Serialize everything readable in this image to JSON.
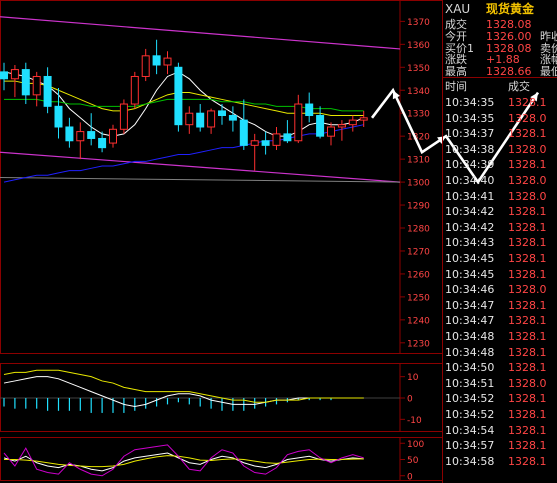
{
  "chart_data": [
    {
      "type": "candlestick",
      "title": "",
      "y_ticks": [
        1230,
        1240,
        1250,
        1260,
        1270,
        1280,
        1290,
        1300,
        1310,
        1320,
        1330,
        1340,
        1350,
        1360,
        1370
      ],
      "ylim": [
        1226,
        1378
      ],
      "candles": [
        {
          "o": 1348,
          "h": 1352,
          "l": 1340,
          "c": 1345
        },
        {
          "o": 1345,
          "h": 1351,
          "l": 1337,
          "c": 1349
        },
        {
          "o": 1349,
          "h": 1352,
          "l": 1334,
          "c": 1338
        },
        {
          "o": 1338,
          "h": 1348,
          "l": 1333,
          "c": 1346
        },
        {
          "o": 1346,
          "h": 1350,
          "l": 1330,
          "c": 1333
        },
        {
          "o": 1333,
          "h": 1341,
          "l": 1319,
          "c": 1324
        },
        {
          "o": 1324,
          "h": 1328,
          "l": 1315,
          "c": 1318
        },
        {
          "o": 1318,
          "h": 1326,
          "l": 1310,
          "c": 1322
        },
        {
          "o": 1322,
          "h": 1330,
          "l": 1316,
          "c": 1319
        },
        {
          "o": 1319,
          "h": 1322,
          "l": 1313,
          "c": 1315
        },
        {
          "o": 1317,
          "h": 1325,
          "l": 1315,
          "c": 1323
        },
        {
          "o": 1323,
          "h": 1336,
          "l": 1321,
          "c": 1334
        },
        {
          "o": 1334,
          "h": 1348,
          "l": 1332,
          "c": 1346
        },
        {
          "o": 1346,
          "h": 1358,
          "l": 1344,
          "c": 1355
        },
        {
          "o": 1355,
          "h": 1362,
          "l": 1347,
          "c": 1351
        },
        {
          "o": 1351,
          "h": 1357,
          "l": 1347,
          "c": 1354
        },
        {
          "o": 1350,
          "h": 1352,
          "l": 1322,
          "c": 1325
        },
        {
          "o": 1325,
          "h": 1333,
          "l": 1321,
          "c": 1330
        },
        {
          "o": 1330,
          "h": 1334,
          "l": 1322,
          "c": 1324
        },
        {
          "o": 1324,
          "h": 1332,
          "l": 1321,
          "c": 1331
        },
        {
          "o": 1331,
          "h": 1334,
          "l": 1325,
          "c": 1329
        },
        {
          "o": 1329,
          "h": 1333,
          "l": 1322,
          "c": 1327
        },
        {
          "o": 1327,
          "h": 1336,
          "l": 1314,
          "c": 1316
        },
        {
          "o": 1316,
          "h": 1321,
          "l": 1305,
          "c": 1318
        },
        {
          "o": 1318,
          "h": 1322,
          "l": 1312,
          "c": 1316
        },
        {
          "o": 1316,
          "h": 1324,
          "l": 1314,
          "c": 1321
        },
        {
          "o": 1321,
          "h": 1327,
          "l": 1317,
          "c": 1318
        },
        {
          "o": 1318,
          "h": 1338,
          "l": 1317,
          "c": 1334
        },
        {
          "o": 1334,
          "h": 1339,
          "l": 1326,
          "c": 1329
        },
        {
          "o": 1329,
          "h": 1333,
          "l": 1319,
          "c": 1320
        },
        {
          "o": 1320,
          "h": 1326,
          "l": 1316,
          "c": 1324
        },
        {
          "o": 1324,
          "h": 1327,
          "l": 1318,
          "c": 1325
        },
        {
          "o": 1325,
          "h": 1329,
          "l": 1322,
          "c": 1327
        },
        {
          "o": 1327,
          "h": 1331,
          "l": 1324,
          "c": 1328
        }
      ],
      "lines": [
        {
          "color": "#ffffff",
          "values": [
            1348,
            1347,
            1346,
            1344,
            1342,
            1338,
            1332,
            1328,
            1324,
            1321,
            1320,
            1321,
            1325,
            1332,
            1340,
            1346,
            1348,
            1345,
            1340,
            1336,
            1333,
            1330,
            1327,
            1325,
            1322,
            1320,
            1320,
            1322,
            1325,
            1326,
            1325,
            1325,
            1326,
            1328
          ]
        },
        {
          "color": "#e8e800",
          "values": [
            1344,
            1344,
            1343,
            1343,
            1342,
            1340,
            1338,
            1336,
            1334,
            1332,
            1331,
            1331,
            1332,
            1334,
            1336,
            1338,
            1339,
            1339,
            1338,
            1337,
            1336,
            1335,
            1334,
            1333,
            1332,
            1331,
            1330,
            1330,
            1330,
            1330,
            1329,
            1329,
            1329,
            1329
          ]
        },
        {
          "color": "#00c000",
          "values": [
            1336,
            1336,
            1336,
            1336,
            1335,
            1335,
            1334,
            1334,
            1333,
            1333,
            1333,
            1333,
            1333,
            1334,
            1335,
            1336,
            1336,
            1336,
            1336,
            1336,
            1335,
            1335,
            1335,
            1334,
            1334,
            1333,
            1333,
            1333,
            1332,
            1332,
            1332,
            1331,
            1331,
            1331
          ]
        },
        {
          "color": "#2020ff",
          "values": [
            1300,
            1301,
            1302,
            1303,
            1303,
            1304,
            1305,
            1305,
            1306,
            1307,
            1307,
            1308,
            1309,
            1309,
            1310,
            1311,
            1312,
            1312,
            1313,
            1314,
            1315,
            1315,
            1316,
            1317,
            1318,
            1318,
            1319,
            1320,
            1321,
            1321,
            1322,
            1323,
            1324,
            1325
          ]
        }
      ],
      "channel_lines": [
        {
          "from": 1372,
          "to": 1358
        },
        {
          "from": 1313,
          "to": 1300
        }
      ],
      "bottom_line": {
        "color": "#808080",
        "from": 1302,
        "to": 1300
      },
      "projection_path": [
        1328,
        1340,
        1313,
        1320,
        1300,
        1339
      ]
    },
    {
      "type": "bar",
      "title": "",
      "y_ticks": [
        10,
        0,
        -10
      ],
      "ylim": [
        -15,
        15
      ],
      "bars": [
        -4,
        -5,
        -5,
        -5,
        -6,
        -6,
        -6,
        -6,
        -7,
        -7,
        -7,
        -7,
        -6,
        -5,
        -4,
        -3,
        -2,
        -3,
        -4,
        -5,
        -6,
        -6,
        -6,
        -5,
        -4,
        -3,
        -2,
        -1,
        -1,
        -1,
        -1,
        0,
        0,
        0
      ],
      "lines": [
        {
          "color": "#ffffff",
          "values": [
            7,
            8,
            9,
            10,
            10,
            9,
            7,
            5,
            3,
            1,
            -1,
            -3,
            -4,
            -3,
            -1,
            1,
            2,
            2,
            1,
            -1,
            -2,
            -3,
            -3,
            -3,
            -2,
            -1,
            -1,
            0,
            0,
            0,
            0,
            0,
            0,
            0
          ]
        },
        {
          "color": "#e8e800",
          "values": [
            11,
            12,
            12,
            13,
            13,
            13,
            12,
            11,
            10,
            8,
            7,
            5,
            4,
            3,
            3,
            3,
            3,
            3,
            2,
            1,
            0,
            -1,
            -1,
            -2,
            -2,
            -1,
            -1,
            -1,
            0,
            0,
            0,
            0,
            0,
            0
          ]
        }
      ]
    },
    {
      "type": "line",
      "title": "",
      "y_ticks": [
        100,
        50,
        0
      ],
      "ylim": [
        -10,
        110
      ],
      "lines": [
        {
          "color": "#ffffff",
          "values": [
            55,
            45,
            60,
            40,
            30,
            25,
            35,
            30,
            20,
            15,
            25,
            45,
            55,
            60,
            65,
            70,
            55,
            40,
            35,
            50,
            60,
            55,
            40,
            30,
            25,
            35,
            50,
            55,
            60,
            50,
            45,
            50,
            55,
            52
          ]
        },
        {
          "color": "#e8e800",
          "values": [
            50,
            50,
            48,
            45,
            40,
            35,
            32,
            30,
            28,
            28,
            30,
            35,
            45,
            52,
            58,
            62,
            60,
            55,
            48,
            47,
            50,
            52,
            50,
            45,
            40,
            38,
            42,
            46,
            50,
            51,
            50,
            50,
            51,
            52
          ]
        },
        {
          "color": "#cc00cc",
          "values": [
            70,
            30,
            85,
            20,
            10,
            5,
            40,
            20,
            5,
            0,
            20,
            60,
            80,
            85,
            90,
            95,
            60,
            20,
            15,
            55,
            80,
            70,
            30,
            10,
            5,
            25,
            65,
            75,
            80,
            55,
            40,
            55,
            65,
            55
          ]
        }
      ]
    }
  ],
  "quote": {
    "symbol": "XAU",
    "name": "现货黄金",
    "rows": [
      {
        "label": "成交",
        "value": "1328.08",
        "extra": ""
      },
      {
        "label": "今开",
        "value": "1326.00",
        "extra": "昨收"
      },
      {
        "label": "买价1",
        "value": "1328.08",
        "extra": "卖价"
      },
      {
        "label": "涨跌",
        "value": "+1.88",
        "extra": "涨幅"
      },
      {
        "label": "最高",
        "value": "1328.66",
        "extra": "最低"
      }
    ],
    "ticks_header": {
      "time": "时间",
      "price": "成交"
    },
    "ticks": [
      {
        "time": "10:34:35",
        "price": "1328.1"
      },
      {
        "time": "10:34:35",
        "price": "1328.0"
      },
      {
        "time": "10:34:37",
        "price": "1328.1"
      },
      {
        "time": "10:34:38",
        "price": "1328.0"
      },
      {
        "time": "10:34:39",
        "price": "1328.1"
      },
      {
        "time": "10:34:40",
        "price": "1328.0"
      },
      {
        "time": "10:34:41",
        "price": "1328.0"
      },
      {
        "time": "10:34:42",
        "price": "1328.1"
      },
      {
        "time": "10:34:42",
        "price": "1328.1"
      },
      {
        "time": "10:34:43",
        "price": "1328.1"
      },
      {
        "time": "10:34:45",
        "price": "1328.1"
      },
      {
        "time": "10:34:45",
        "price": "1328.1"
      },
      {
        "time": "10:34:46",
        "price": "1328.0"
      },
      {
        "time": "10:34:47",
        "price": "1328.1"
      },
      {
        "time": "10:34:47",
        "price": "1328.1"
      },
      {
        "time": "10:34:48",
        "price": "1328.1"
      },
      {
        "time": "10:34:48",
        "price": "1328.1"
      },
      {
        "time": "10:34:50",
        "price": "1328.1"
      },
      {
        "time": "10:34:51",
        "price": "1328.0"
      },
      {
        "time": "10:34:52",
        "price": "1328.1"
      },
      {
        "time": "10:34:52",
        "price": "1328.1"
      },
      {
        "time": "10:34:54",
        "price": "1328.1"
      },
      {
        "time": "10:34:57",
        "price": "1328.1"
      },
      {
        "time": "10:34:58",
        "price": "1328.1"
      }
    ]
  },
  "colors": {
    "up": "#ff3030",
    "down": "#20e0ff",
    "axis": "#ff4545",
    "grid": "#8b0000",
    "channel": "#cc33cc"
  }
}
